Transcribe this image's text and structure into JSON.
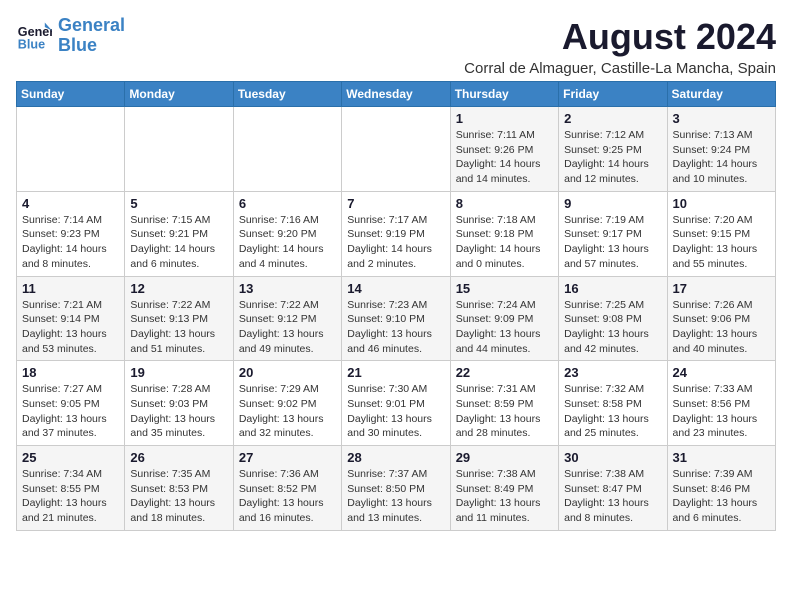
{
  "logo": {
    "line1": "General",
    "line2": "Blue"
  },
  "title": "August 2024",
  "location": "Corral de Almaguer, Castille-La Mancha, Spain",
  "days_of_week": [
    "Sunday",
    "Monday",
    "Tuesday",
    "Wednesday",
    "Thursday",
    "Friday",
    "Saturday"
  ],
  "weeks": [
    [
      {
        "num": "",
        "info": ""
      },
      {
        "num": "",
        "info": ""
      },
      {
        "num": "",
        "info": ""
      },
      {
        "num": "",
        "info": ""
      },
      {
        "num": "1",
        "info": "Sunrise: 7:11 AM\nSunset: 9:26 PM\nDaylight: 14 hours\nand 14 minutes."
      },
      {
        "num": "2",
        "info": "Sunrise: 7:12 AM\nSunset: 9:25 PM\nDaylight: 14 hours\nand 12 minutes."
      },
      {
        "num": "3",
        "info": "Sunrise: 7:13 AM\nSunset: 9:24 PM\nDaylight: 14 hours\nand 10 minutes."
      }
    ],
    [
      {
        "num": "4",
        "info": "Sunrise: 7:14 AM\nSunset: 9:23 PM\nDaylight: 14 hours\nand 8 minutes."
      },
      {
        "num": "5",
        "info": "Sunrise: 7:15 AM\nSunset: 9:21 PM\nDaylight: 14 hours\nand 6 minutes."
      },
      {
        "num": "6",
        "info": "Sunrise: 7:16 AM\nSunset: 9:20 PM\nDaylight: 14 hours\nand 4 minutes."
      },
      {
        "num": "7",
        "info": "Sunrise: 7:17 AM\nSunset: 9:19 PM\nDaylight: 14 hours\nand 2 minutes."
      },
      {
        "num": "8",
        "info": "Sunrise: 7:18 AM\nSunset: 9:18 PM\nDaylight: 14 hours\nand 0 minutes."
      },
      {
        "num": "9",
        "info": "Sunrise: 7:19 AM\nSunset: 9:17 PM\nDaylight: 13 hours\nand 57 minutes."
      },
      {
        "num": "10",
        "info": "Sunrise: 7:20 AM\nSunset: 9:15 PM\nDaylight: 13 hours\nand 55 minutes."
      }
    ],
    [
      {
        "num": "11",
        "info": "Sunrise: 7:21 AM\nSunset: 9:14 PM\nDaylight: 13 hours\nand 53 minutes."
      },
      {
        "num": "12",
        "info": "Sunrise: 7:22 AM\nSunset: 9:13 PM\nDaylight: 13 hours\nand 51 minutes."
      },
      {
        "num": "13",
        "info": "Sunrise: 7:22 AM\nSunset: 9:12 PM\nDaylight: 13 hours\nand 49 minutes."
      },
      {
        "num": "14",
        "info": "Sunrise: 7:23 AM\nSunset: 9:10 PM\nDaylight: 13 hours\nand 46 minutes."
      },
      {
        "num": "15",
        "info": "Sunrise: 7:24 AM\nSunset: 9:09 PM\nDaylight: 13 hours\nand 44 minutes."
      },
      {
        "num": "16",
        "info": "Sunrise: 7:25 AM\nSunset: 9:08 PM\nDaylight: 13 hours\nand 42 minutes."
      },
      {
        "num": "17",
        "info": "Sunrise: 7:26 AM\nSunset: 9:06 PM\nDaylight: 13 hours\nand 40 minutes."
      }
    ],
    [
      {
        "num": "18",
        "info": "Sunrise: 7:27 AM\nSunset: 9:05 PM\nDaylight: 13 hours\nand 37 minutes."
      },
      {
        "num": "19",
        "info": "Sunrise: 7:28 AM\nSunset: 9:03 PM\nDaylight: 13 hours\nand 35 minutes."
      },
      {
        "num": "20",
        "info": "Sunrise: 7:29 AM\nSunset: 9:02 PM\nDaylight: 13 hours\nand 32 minutes."
      },
      {
        "num": "21",
        "info": "Sunrise: 7:30 AM\nSunset: 9:01 PM\nDaylight: 13 hours\nand 30 minutes."
      },
      {
        "num": "22",
        "info": "Sunrise: 7:31 AM\nSunset: 8:59 PM\nDaylight: 13 hours\nand 28 minutes."
      },
      {
        "num": "23",
        "info": "Sunrise: 7:32 AM\nSunset: 8:58 PM\nDaylight: 13 hours\nand 25 minutes."
      },
      {
        "num": "24",
        "info": "Sunrise: 7:33 AM\nSunset: 8:56 PM\nDaylight: 13 hours\nand 23 minutes."
      }
    ],
    [
      {
        "num": "25",
        "info": "Sunrise: 7:34 AM\nSunset: 8:55 PM\nDaylight: 13 hours\nand 21 minutes."
      },
      {
        "num": "26",
        "info": "Sunrise: 7:35 AM\nSunset: 8:53 PM\nDaylight: 13 hours\nand 18 minutes."
      },
      {
        "num": "27",
        "info": "Sunrise: 7:36 AM\nSunset: 8:52 PM\nDaylight: 13 hours\nand 16 minutes."
      },
      {
        "num": "28",
        "info": "Sunrise: 7:37 AM\nSunset: 8:50 PM\nDaylight: 13 hours\nand 13 minutes."
      },
      {
        "num": "29",
        "info": "Sunrise: 7:38 AM\nSunset: 8:49 PM\nDaylight: 13 hours\nand 11 minutes."
      },
      {
        "num": "30",
        "info": "Sunrise: 7:38 AM\nSunset: 8:47 PM\nDaylight: 13 hours\nand 8 minutes."
      },
      {
        "num": "31",
        "info": "Sunrise: 7:39 AM\nSunset: 8:46 PM\nDaylight: 13 hours\nand 6 minutes."
      }
    ]
  ]
}
